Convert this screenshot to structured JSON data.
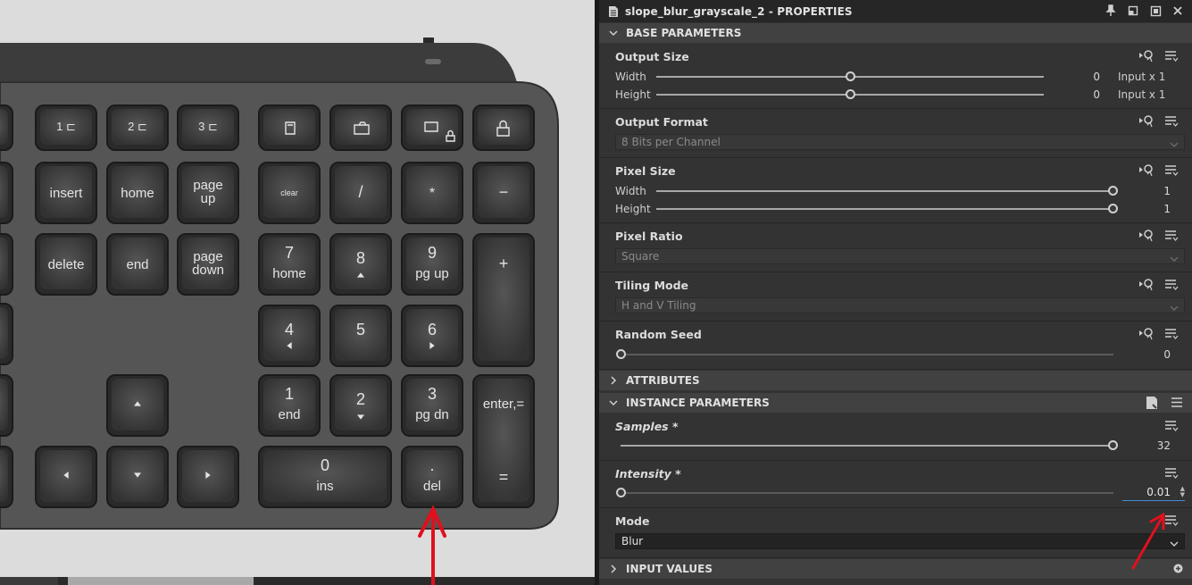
{
  "keyboard": {
    "function_keys": [
      {
        "label": "1",
        "icon": "device-icon"
      },
      {
        "label": "2",
        "icon": "device-icon"
      },
      {
        "label": "3",
        "icon": "device-icon"
      },
      {
        "label": "",
        "icon": "calculator-icon"
      },
      {
        "label": "",
        "icon": "camera-icon"
      },
      {
        "label": "",
        "icon": "screen-lock-icon"
      },
      {
        "label": "",
        "icon": "lock-icon"
      }
    ],
    "nav_keys": {
      "insert": "insert",
      "home": "home",
      "page_up": [
        "page",
        "up"
      ],
      "delete": "delete",
      "end": "end",
      "page_down": [
        "page",
        "down"
      ]
    },
    "numpad": {
      "clear": "clear",
      "divide": "/",
      "multiply": "*",
      "minus": "−",
      "plus": "+",
      "n7": [
        "7",
        "home"
      ],
      "n8": [
        "8",
        ""
      ],
      "n9": [
        "9",
        "pg up"
      ],
      "n4": [
        "4",
        ""
      ],
      "n5": [
        "5",
        ""
      ],
      "n6": [
        "6",
        ""
      ],
      "n1": [
        "1",
        "end"
      ],
      "n2": [
        "2",
        ""
      ],
      "n3": [
        "3",
        "pg dn"
      ],
      "n0": [
        "0",
        "ins"
      ],
      "dot": [
        ".",
        "del"
      ],
      "enter": [
        "enter",
        "="
      ]
    }
  },
  "panel": {
    "title": "slope_blur_grayscale_2 - PROPERTIES",
    "sections": {
      "base": "BASE PARAMETERS",
      "attributes": "ATTRIBUTES",
      "instance": "INSTANCE PARAMETERS",
      "inputs": "INPUT VALUES"
    },
    "output_size": {
      "title": "Output Size",
      "width_label": "Width",
      "width_value": "0",
      "width_suffix": "Input x 1",
      "height_label": "Height",
      "height_value": "0",
      "height_suffix": "Input x 1",
      "width_fill": 0.5,
      "height_fill": 0.5
    },
    "output_format": {
      "title": "Output Format",
      "value": "8 Bits per Channel"
    },
    "pixel_size": {
      "title": "Pixel Size",
      "width_label": "Width",
      "width_value": "1",
      "height_label": "Height",
      "height_value": "1",
      "width_fill": 1.0,
      "height_fill": 1.0
    },
    "pixel_ratio": {
      "title": "Pixel Ratio",
      "value": "Square"
    },
    "tiling_mode": {
      "title": "Tiling Mode",
      "value": "H and V Tiling"
    },
    "random_seed": {
      "title": "Random Seed",
      "value": "0",
      "fill": 0.0
    },
    "samples": {
      "title": "Samples *",
      "value": "32",
      "fill": 1.0
    },
    "intensity": {
      "title": "Intensity *",
      "value": "0.01",
      "fill": 0.0
    },
    "mode": {
      "title": "Mode",
      "value": "Blur"
    }
  },
  "colors": {
    "panel_bg": "#333333",
    "header_bg": "#414141",
    "accent": "#3d8bdc",
    "annotation_arrow": "#e0101c"
  }
}
